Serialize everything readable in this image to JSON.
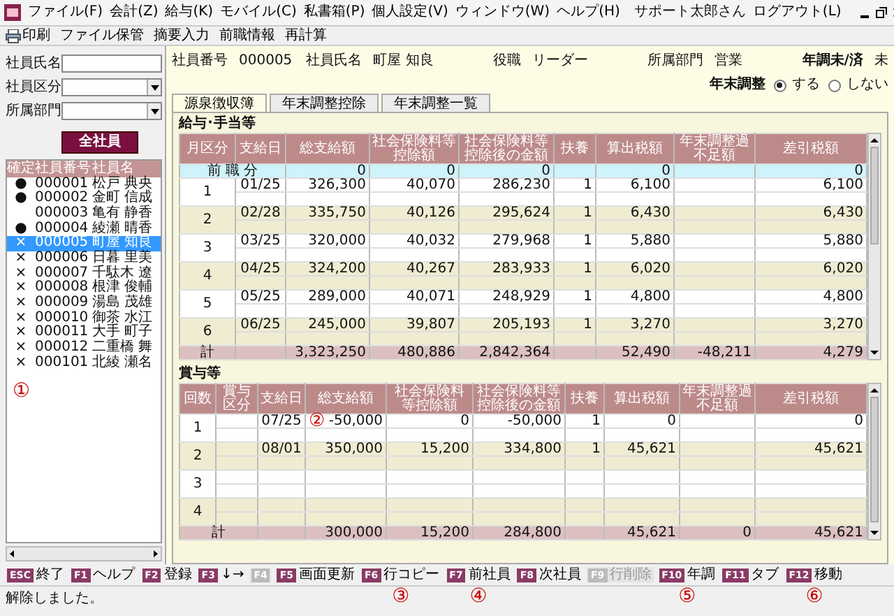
{
  "menu": [
    "ファイル(F)",
    "会計(Z)",
    "給与(K)",
    "モバイル(C)",
    "私書箱(P)",
    "個人設定(V)",
    "ウィンドウ(W)",
    "ヘルプ(H)"
  ],
  "user": "サポート太郎さん",
  "logout": "ログアウト(L)",
  "toolbar": [
    {
      "label": "印刷",
      "kind": "print"
    },
    {
      "label": "ファイル保管",
      "kind": "text"
    },
    {
      "label": "摘要入力",
      "kind": "text"
    },
    {
      "label": "前職情報",
      "kind": "text"
    },
    {
      "label": "再計算",
      "kind": "text"
    }
  ],
  "filters": [
    {
      "label": "社員氏名",
      "kind": "text"
    },
    {
      "label": "社員区分",
      "kind": "select"
    },
    {
      "label": "所属部門",
      "kind": "select"
    }
  ],
  "all_button": "全社員",
  "employee_list": {
    "columns": [
      "確定",
      "社員番号",
      "社員名"
    ],
    "annotation": "①",
    "rows": [
      {
        "mark": "●",
        "number": "000001",
        "name": "松戸 典央",
        "selected": false
      },
      {
        "mark": "●",
        "number": "000002",
        "name": "金町 信成",
        "selected": false
      },
      {
        "number": "000003",
        "name": "亀有 静香",
        "selected": false
      },
      {
        "mark": "●",
        "number": "000004",
        "name": "綾瀬 晴香",
        "selected": false
      },
      {
        "mark": "×",
        "number": "000005",
        "name": "町屋 知良",
        "selected": true
      },
      {
        "mark": "×",
        "number": "000006",
        "name": "日暮 里美",
        "selected": false
      },
      {
        "mark": "×",
        "number": "000007",
        "name": "千駄木 遼",
        "selected": false
      },
      {
        "mark": "×",
        "number": "000008",
        "name": "根津 俊輔",
        "selected": false
      },
      {
        "mark": "×",
        "number": "000009",
        "name": "湯島 茂雄",
        "selected": false
      },
      {
        "mark": "×",
        "number": "000010",
        "name": "御茶 水江",
        "selected": false
      },
      {
        "mark": "×",
        "number": "000011",
        "name": "大手 町子",
        "selected": false
      },
      {
        "mark": "×",
        "number": "000012",
        "name": "二重橋 舞",
        "selected": false
      },
      {
        "mark": "×",
        "number": "000101",
        "name": "北綾 瀬名",
        "selected": false
      }
    ]
  },
  "employee_info": [
    {
      "label": "社員番号",
      "value": "000005",
      "kind": "plain"
    },
    {
      "label": "社員氏名",
      "value": "町屋 知良",
      "kind": "plain"
    },
    {
      "label": "役職",
      "value": "リーダー",
      "kind": "plain"
    },
    {
      "label": "所属部門",
      "value": "営業",
      "kind": "plain"
    },
    {
      "label": "年調未/済",
      "value": "未",
      "kind": "status"
    }
  ],
  "year_end": {
    "label": "年末調整",
    "options": [
      {
        "label": "する",
        "selected": true
      },
      {
        "label": "しない",
        "selected": false
      }
    ]
  },
  "tabs": [
    {
      "label": "源泉徴収簿",
      "selected": true
    },
    {
      "label": "年末調整控除",
      "selected": false
    },
    {
      "label": "年末調整一覧",
      "selected": false
    }
  ],
  "salary": {
    "title": "給与･手当等",
    "columns": [
      "月区分",
      "支給日",
      "総支給額",
      "社会保険料等控除額",
      "社会保険料等控除後の金額",
      "扶養",
      "算出税額",
      "年末調整過不足額",
      "差引税額"
    ],
    "previous_job": {
      "label": "前 職 分",
      "gross": "0",
      "insurance": "0",
      "after_insurance": "0",
      "tax": "0",
      "net": "0"
    },
    "rows": [
      {
        "period": "1",
        "date": "01/25",
        "gross": "326,300",
        "insurance": "40,070",
        "after_insurance": "286,230",
        "dependents": "1",
        "tax": "6,100",
        "net": "6,100"
      },
      {
        "period": "2",
        "date": "02/28",
        "gross": "335,750",
        "insurance": "40,126",
        "after_insurance": "295,624",
        "dependents": "1",
        "tax": "6,430",
        "net": "6,430"
      },
      {
        "period": "3",
        "date": "03/25",
        "gross": "320,000",
        "insurance": "40,032",
        "after_insurance": "279,968",
        "dependents": "1",
        "tax": "5,880",
        "net": "5,880"
      },
      {
        "period": "4",
        "date": "04/25",
        "gross": "324,200",
        "insurance": "40,267",
        "after_insurance": "283,933",
        "dependents": "1",
        "tax": "6,020",
        "net": "6,020"
      },
      {
        "period": "5",
        "date": "05/25",
        "gross": "289,000",
        "insurance": "40,071",
        "after_insurance": "248,929",
        "dependents": "1",
        "tax": "4,800",
        "net": "4,800"
      },
      {
        "period": "6",
        "date": "06/25",
        "gross": "245,000",
        "insurance": "39,807",
        "after_insurance": "205,193",
        "dependents": "1",
        "tax": "3,270",
        "net": "3,270"
      }
    ],
    "total": {
      "label": "計",
      "gross": "3,323,250",
      "insurance": "480,886",
      "after_insurance": "2,842,364",
      "tax": "52,490",
      "adjustment": "-48,211",
      "net": "4,279"
    }
  },
  "bonus": {
    "title": "賞与等",
    "columns": [
      "回数",
      "賞与区分",
      "支給日",
      "総支給額",
      "社会保険料等控除額",
      "社会保険料等控除後の金額",
      "扶養",
      "算出税額",
      "年末調整過不足額",
      "差引税額"
    ],
    "annotation": "②",
    "rows": [
      {
        "count": "1",
        "date": "07/25",
        "gross": "-50,000",
        "insurance": "0",
        "after_insurance": "-50,000",
        "dependents": "1",
        "tax": "0",
        "net": "0"
      },
      {
        "count": "2",
        "date": "08/01",
        "gross": "350,000",
        "insurance": "15,200",
        "after_insurance": "334,800",
        "dependents": "1",
        "tax": "45,621",
        "net": "45,621"
      },
      {
        "count": "3"
      },
      {
        "count": "4"
      }
    ],
    "total": {
      "label": "計",
      "gross": "300,000",
      "insurance": "15,200",
      "after_insurance": "284,800",
      "tax": "45,621",
      "adjustment": "0",
      "net": "45,621"
    }
  },
  "function_keys": [
    {
      "key": "ESC",
      "label": "終了",
      "disabled": false
    },
    {
      "key": "F1",
      "label": "ヘルプ",
      "disabled": false
    },
    {
      "key": "F2",
      "label": "登録",
      "disabled": false
    },
    {
      "key": "F3",
      "label": "↓→",
      "disabled": false
    },
    {
      "key": "F4",
      "disabled": true
    },
    {
      "key": "F5",
      "label": "画面更新",
      "disabled": false
    },
    {
      "key": "F6",
      "label": "行コピー",
      "disabled": false,
      "annotation": "③"
    },
    {
      "key": "F7",
      "label": "前社員",
      "disabled": false,
      "annotation": "④"
    },
    {
      "key": "F8",
      "label": "次社員",
      "disabled": false
    },
    {
      "key": "F9",
      "label": "行削除",
      "disabled": true
    },
    {
      "key": "F10",
      "label": "年調",
      "disabled": false,
      "annotation": "⑤"
    },
    {
      "key": "F11",
      "label": "タブ",
      "disabled": false
    },
    {
      "key": "F12",
      "label": "移動",
      "disabled": false,
      "annotation": "⑥"
    }
  ],
  "status_bar": "解除しました。"
}
